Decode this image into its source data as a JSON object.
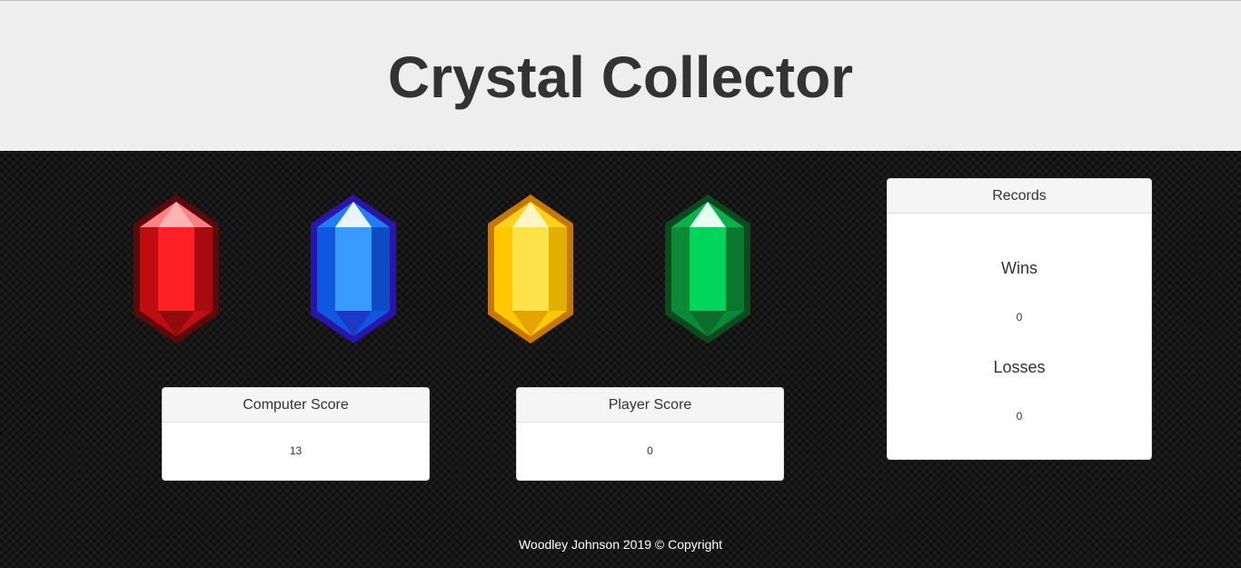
{
  "header": {
    "title": "Crystal Collector"
  },
  "crystals": [
    {
      "name": "red",
      "colors": {
        "outline": "#5a0a0a",
        "dark": "#c00d12",
        "mid": "#ff2025",
        "light": "#ff8082",
        "tip": "#ffb3b4"
      }
    },
    {
      "name": "blue",
      "colors": {
        "outline": "#2b14a8",
        "dark": "#0f56e0",
        "mid": "#3a9bff",
        "light": "#1f7df5",
        "tip": "#eaf4ff"
      }
    },
    {
      "name": "yellow",
      "colors": {
        "outline": "#c87800",
        "dark": "#ffc800",
        "mid": "#ffe24a",
        "light": "#ffd21a",
        "tip": "#fff4c4"
      }
    },
    {
      "name": "green",
      "colors": {
        "outline": "#0b4a1f",
        "dark": "#0c8a36",
        "mid": "#00d45a",
        "light": "#08b24a",
        "tip": "#e6fff0"
      }
    }
  ],
  "scores": {
    "computer": {
      "label": "Computer Score",
      "value": "13"
    },
    "player": {
      "label": "Player Score",
      "value": "0"
    }
  },
  "records": {
    "title": "Records",
    "wins_label": "Wins",
    "wins_value": "0",
    "losses_label": "Losses",
    "losses_value": "0"
  },
  "footer": {
    "text": "Woodley Johnson 2019 © Copyright"
  }
}
